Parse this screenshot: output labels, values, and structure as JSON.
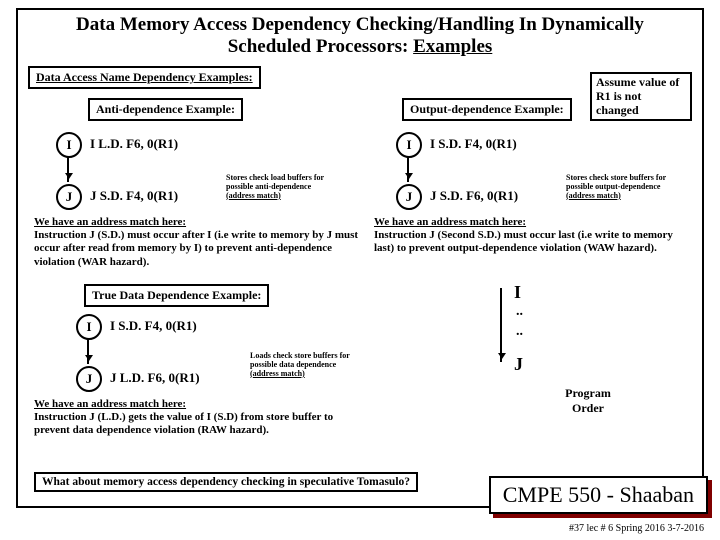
{
  "title_l1": "Data Memory Access Dependency Checking/Handling In Dynamically",
  "title_l2_a": "Scheduled Processors:  ",
  "title_l2_b": "Examples",
  "subhead": "Data Access Name Dependency Examples:",
  "assume": "Assume value of R1 is not changed",
  "anti": {
    "label": "Anti-dependence Example:",
    "I": "I   L.D.  F6,  0(R1)",
    "J": "J   S.D.  F4,  0(R1)",
    "note1": "Stores check load buffers for possible anti-dependence",
    "note2": "(address match)",
    "para_u": "We have an address match here:",
    "para": "Instruction J (S.D.) must occur after I (i.e write to memory by J must occur after read from memory by I) to prevent anti-dependence violation (WAR hazard)."
  },
  "out": {
    "label": "Output-dependence Example:",
    "I": "I   S.D.  F4,  0(R1)",
    "J": "J   S.D.  F6,  0(R1)",
    "note1": "Stores check store buffers for possible output-dependence",
    "note2": "(address match)",
    "para_u": "We have an address match here:",
    "para": "Instruction J (Second S.D.) must occur last (i.e write to memory last) to prevent output-dependence violation (WAW hazard)."
  },
  "true": {
    "label": "True Data Dependence Example:",
    "I": "I   S.D.  F4,  0(R1)",
    "J": "J   L.D.  F6,  0(R1)",
    "note1": "Loads check store buffers for possible data dependence",
    "note2": "(address match)",
    "para_u": "We have an address match here:",
    "para": "Instruction J (L.D.)  gets the value of I (S.D) from store buffer to prevent data dependence violation (RAW hazard)."
  },
  "progorder": {
    "I": "I",
    "dots": "..",
    "J": "J",
    "label": "Program Order"
  },
  "question": "What about memory access dependency checking in speculative Tomasulo?",
  "cmpe": "CMPE 550 - Shaaban",
  "footer": "#37  lec # 6   Spring 2016   3-7-2016"
}
